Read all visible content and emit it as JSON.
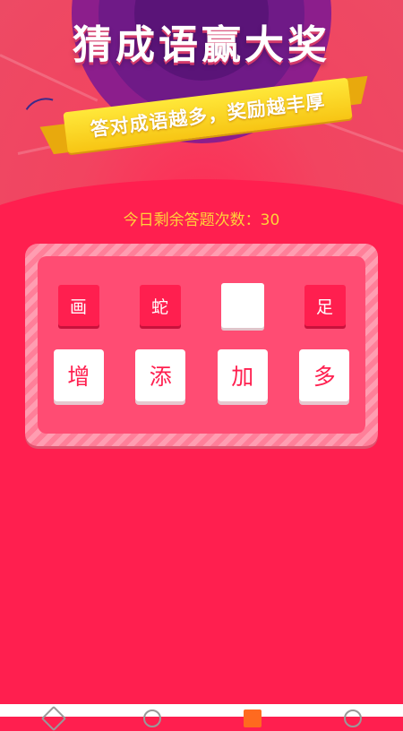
{
  "header": {
    "title": "猜成语赢大奖",
    "ribbon_text": "答对成语越多，奖励越丰厚"
  },
  "status": {
    "remaining_text": "今日剩余答题次数：30"
  },
  "puzzle": {
    "chars": [
      "画",
      "蛇",
      "",
      "足"
    ]
  },
  "options": [
    "增",
    "添",
    "加",
    "多"
  ],
  "bottom_nav": {
    "icons": [
      "home-icon",
      "message-icon",
      "game-icon",
      "profile-icon"
    ],
    "active_index": 2
  },
  "colors": {
    "background": "#ff1f4f",
    "accent_yellow": "#ffd23a",
    "ribbon": "#f7c514",
    "purple": "#6f1a87"
  }
}
